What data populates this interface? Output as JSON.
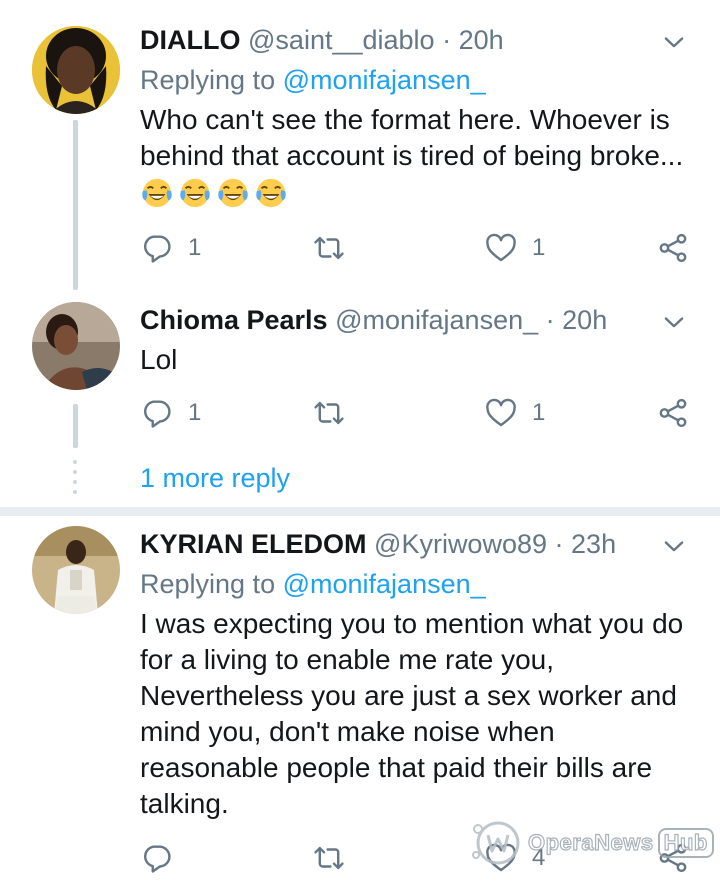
{
  "tweets": [
    {
      "name": "DIALLO",
      "handle": "@saint__diablo",
      "separator": "·",
      "time": "20h",
      "replying_prefix": "Replying to",
      "replying_to": "@monifajansen_",
      "text": "Who can't see the format here. Whoever is behind that account is tired of being broke...",
      "emojis": [
        "face-with-tears-of-joy-icon",
        "face-with-tears-of-joy-icon",
        "face-with-tears-of-joy-icon",
        "face-with-tears-of-joy-icon"
      ],
      "reply_count": "1",
      "retweet_count": "",
      "like_count": "1"
    },
    {
      "name": "Chioma Pearls",
      "handle": "@monifajansen_",
      "separator": "·",
      "time": "20h",
      "text": "Lol",
      "reply_count": "1",
      "retweet_count": "",
      "like_count": "1"
    },
    {
      "name": "KYRIAN ELEDOM",
      "handle": "@Kyriwowo89",
      "separator": "·",
      "time": "23h",
      "replying_prefix": "Replying to",
      "replying_to": "@monifajansen_",
      "text": "I was expecting you to mention what you do for a living to enable me rate you, Nevertheless you are just a sex worker and mind you, don't make noise when reasonable people that paid their bills are talking.",
      "reply_count": "",
      "retweet_count": "",
      "like_count": "4"
    }
  ],
  "more_replies_label": "1 more reply",
  "watermark": {
    "brand": "OperaNews",
    "hub": "Hub"
  },
  "colors": {
    "link": "#1da1f2",
    "secondary": "#657786",
    "thread": "#ccd6dd",
    "divider": "#e6ecf0"
  }
}
